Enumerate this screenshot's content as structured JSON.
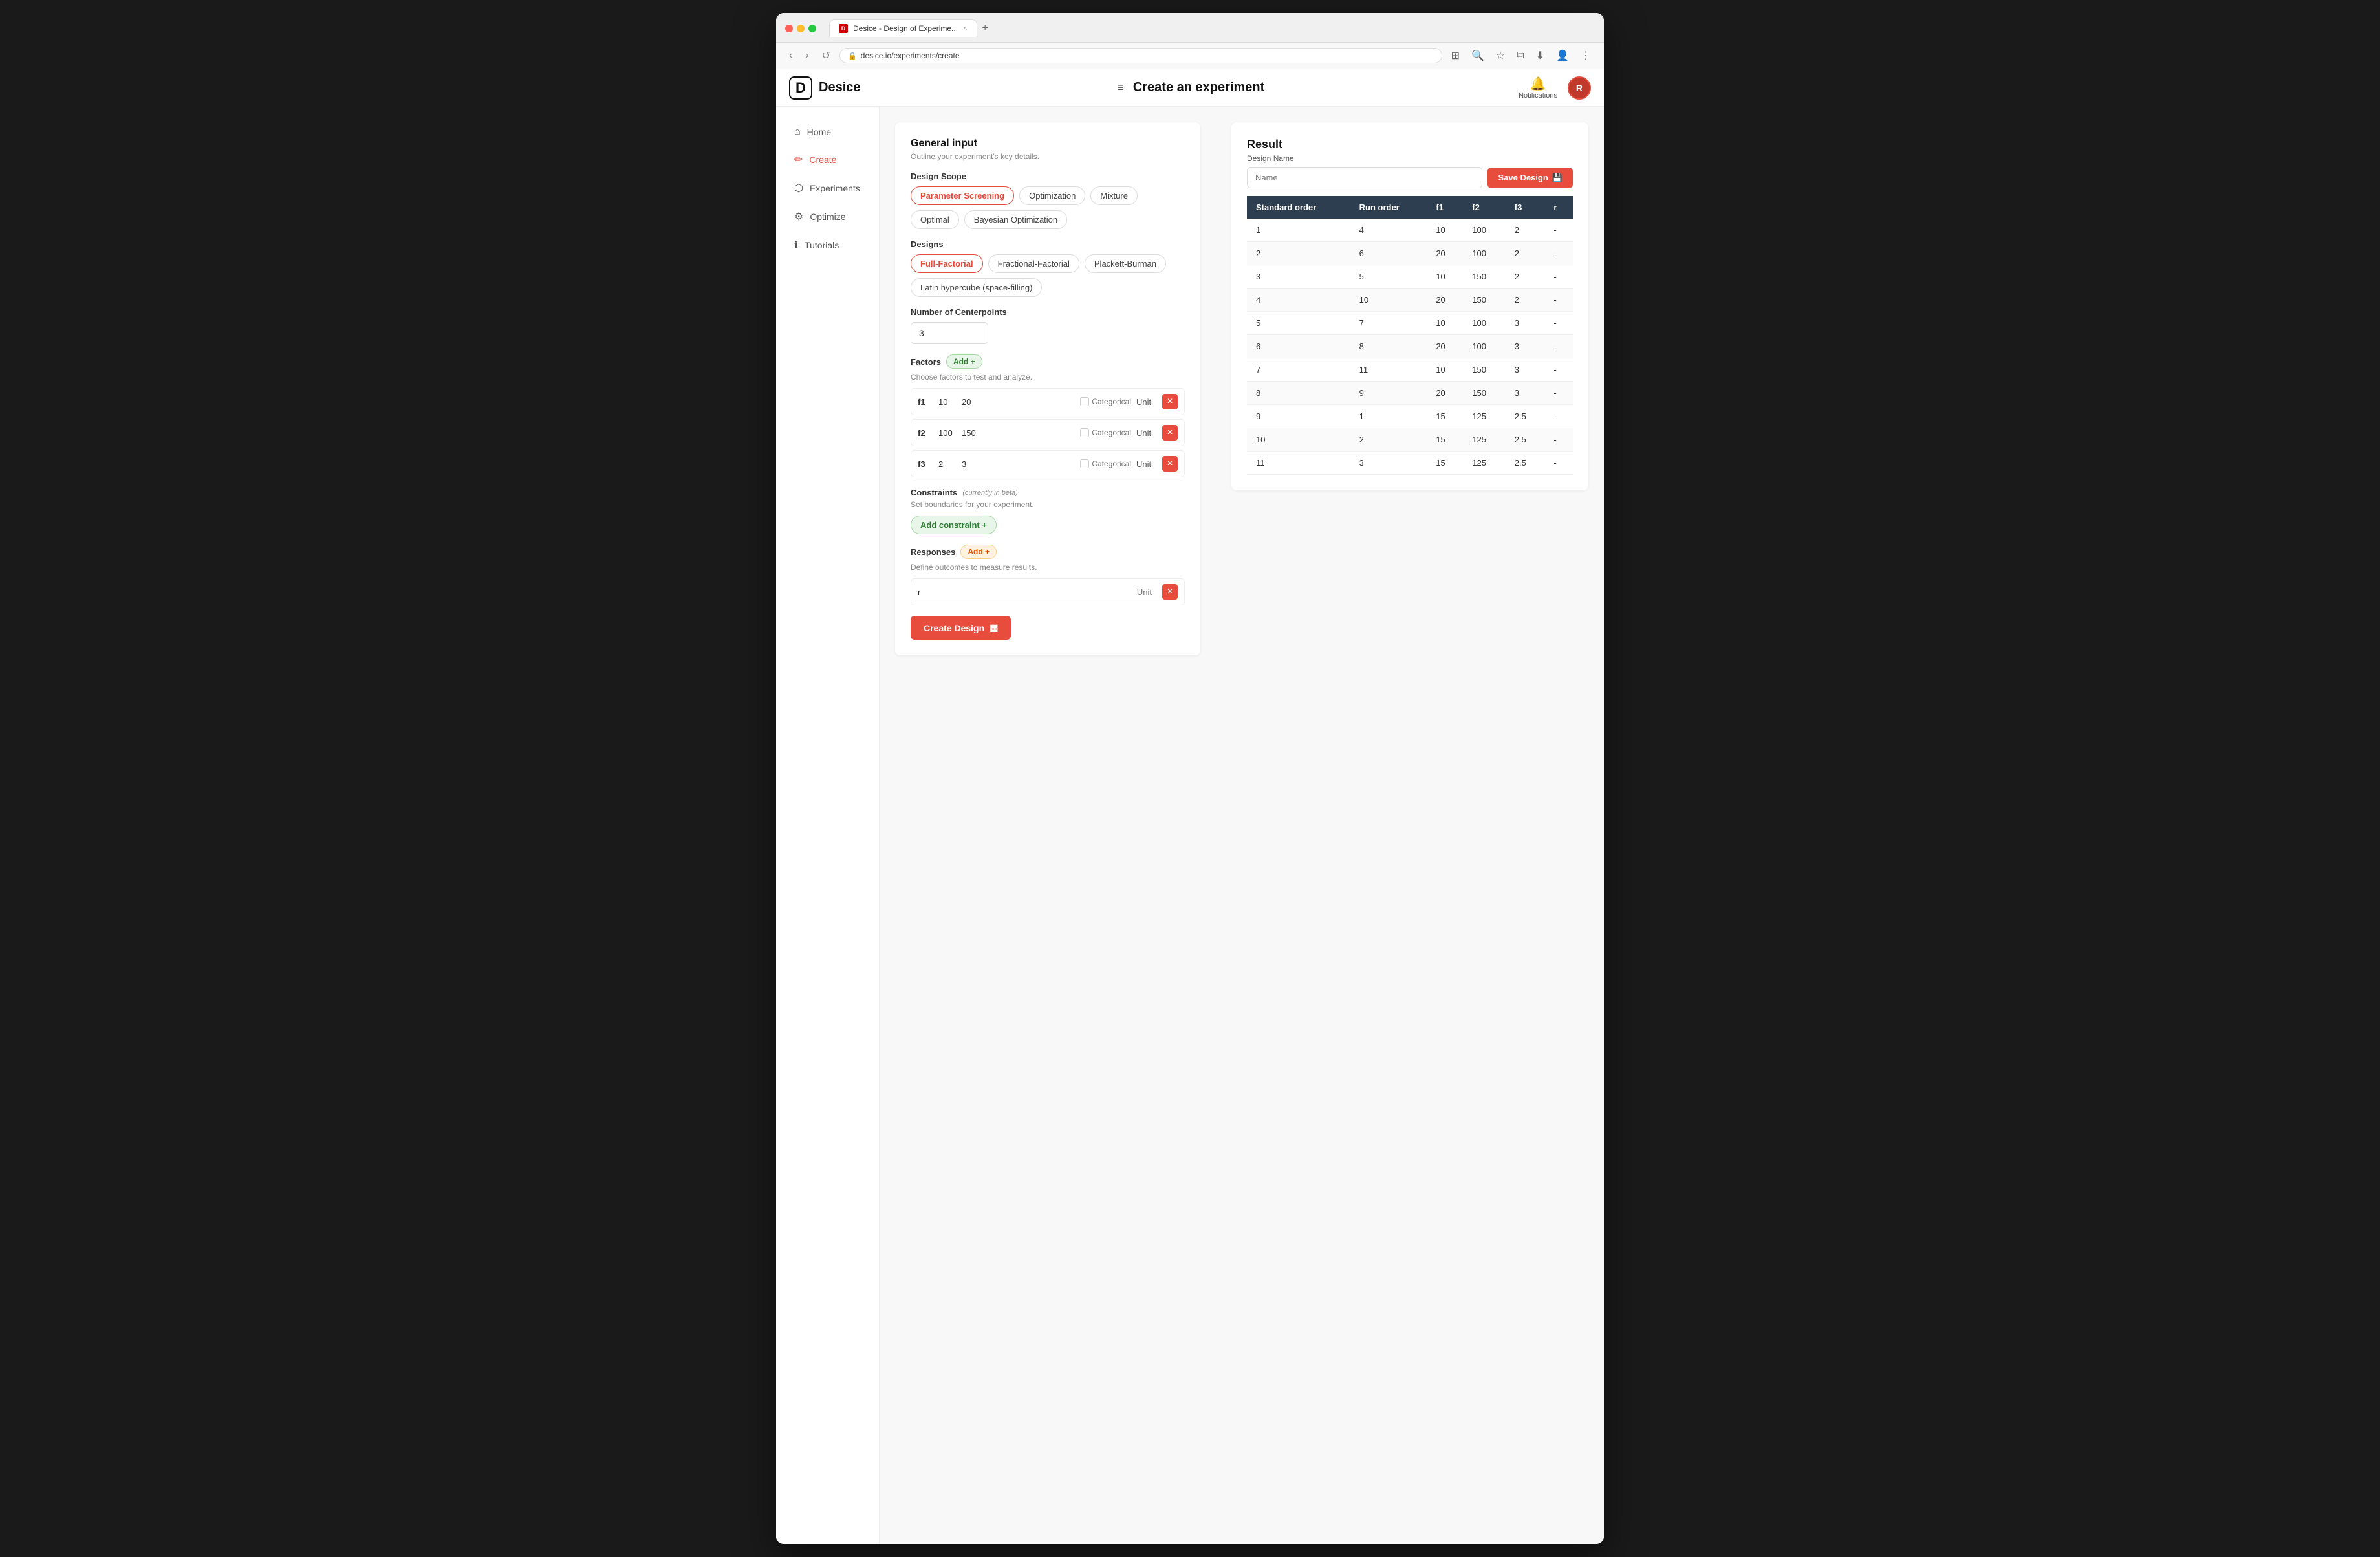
{
  "browser": {
    "tab_title": "Desice - Design of Experime...",
    "tab_close": "×",
    "new_tab": "+",
    "nav_back": "‹",
    "nav_forward": "›",
    "nav_refresh": "↺",
    "address": "desice.io/experiments/create",
    "address_icon": "🔒"
  },
  "app": {
    "logo_letter": "D",
    "logo_name": "Desice",
    "hamburger": "≡",
    "page_title": "Create an experiment",
    "notifications_label": "Notifications",
    "user_initials": "R"
  },
  "sidebar": {
    "items": [
      {
        "id": "home",
        "label": "Home",
        "icon": "⌂",
        "active": false
      },
      {
        "id": "create",
        "label": "Create",
        "icon": "✏",
        "active": true
      },
      {
        "id": "experiments",
        "label": "Experiments",
        "icon": "⬡",
        "active": false
      },
      {
        "id": "optimize",
        "label": "Optimize",
        "icon": "⚙",
        "active": false
      },
      {
        "id": "tutorials",
        "label": "Tutorials",
        "icon": "ℹ",
        "active": false
      }
    ]
  },
  "form": {
    "section_title": "General input",
    "section_subtitle": "Outline your experiment's key details.",
    "design_scope_label": "Design Scope",
    "scope_buttons": [
      {
        "id": "parameter-screening",
        "label": "Parameter Screening",
        "active": true
      },
      {
        "id": "optimization",
        "label": "Optimization",
        "active": false
      },
      {
        "id": "mixture",
        "label": "Mixture",
        "active": false
      },
      {
        "id": "optimal",
        "label": "Optimal",
        "active": false
      },
      {
        "id": "bayesian-optimization",
        "label": "Bayesian Optimization",
        "active": false
      }
    ],
    "designs_label": "Designs",
    "design_buttons": [
      {
        "id": "full-factorial",
        "label": "Full-Factorial",
        "active": true
      },
      {
        "id": "fractional-factorial",
        "label": "Fractional-Factorial",
        "active": false
      },
      {
        "id": "plackett-burman",
        "label": "Plackett-Burman",
        "active": false
      },
      {
        "id": "latin-hypercube",
        "label": "Latin hypercube (space-filling)",
        "active": false
      }
    ],
    "centerpoints_label": "Number of Centerpoints",
    "centerpoints_value": "3",
    "factors_label": "Factors",
    "add_factor_label": "Add +",
    "factors_subtitle": "Choose factors to test and analyze.",
    "factors": [
      {
        "name": "f1",
        "min": "10",
        "max": "20",
        "categorical": false,
        "unit": "Unit"
      },
      {
        "name": "f2",
        "min": "100",
        "max": "150",
        "categorical": false,
        "unit": "Unit"
      },
      {
        "name": "f3",
        "min": "2",
        "max": "3",
        "categorical": false,
        "unit": "Unit"
      }
    ],
    "constraints_label": "Constraints",
    "constraints_beta": "(currently in beta)",
    "constraints_subtitle": "Set boundaries for your experiment.",
    "add_constraint_label": "Add constraint +",
    "responses_label": "Responses",
    "add_response_label": "Add +",
    "responses_subtitle": "Define outcomes to measure results.",
    "responses": [
      {
        "name": "r",
        "unit": "Unit"
      }
    ],
    "create_design_label": "Create Design",
    "create_design_icon": "▦"
  },
  "result": {
    "title": "Result",
    "design_name_label": "Design Name",
    "design_name_placeholder": "Name",
    "save_design_label": "Save Design",
    "save_icon": "💾",
    "table": {
      "columns": [
        "Standard order",
        "Run order",
        "f1",
        "f2",
        "f3",
        "r"
      ],
      "rows": [
        {
          "std": "1",
          "run": "4",
          "f1": "10",
          "f2": "100",
          "f3": "2",
          "r": "-"
        },
        {
          "std": "2",
          "run": "6",
          "f1": "20",
          "f2": "100",
          "f3": "2",
          "r": "-"
        },
        {
          "std": "3",
          "run": "5",
          "f1": "10",
          "f2": "150",
          "f3": "2",
          "r": "-"
        },
        {
          "std": "4",
          "run": "10",
          "f1": "20",
          "f2": "150",
          "f3": "2",
          "r": "-"
        },
        {
          "std": "5",
          "run": "7",
          "f1": "10",
          "f2": "100",
          "f3": "3",
          "r": "-"
        },
        {
          "std": "6",
          "run": "8",
          "f1": "20",
          "f2": "100",
          "f3": "3",
          "r": "-"
        },
        {
          "std": "7",
          "run": "11",
          "f1": "10",
          "f2": "150",
          "f3": "3",
          "r": "-"
        },
        {
          "std": "8",
          "run": "9",
          "f1": "20",
          "f2": "150",
          "f3": "3",
          "r": "-"
        },
        {
          "std": "9",
          "run": "1",
          "f1": "15",
          "f2": "125",
          "f3": "2.5",
          "r": "-"
        },
        {
          "std": "10",
          "run": "2",
          "f1": "15",
          "f2": "125",
          "f3": "2.5",
          "r": "-"
        },
        {
          "std": "11",
          "run": "3",
          "f1": "15",
          "f2": "125",
          "f3": "2.5",
          "r": "-"
        }
      ]
    }
  }
}
